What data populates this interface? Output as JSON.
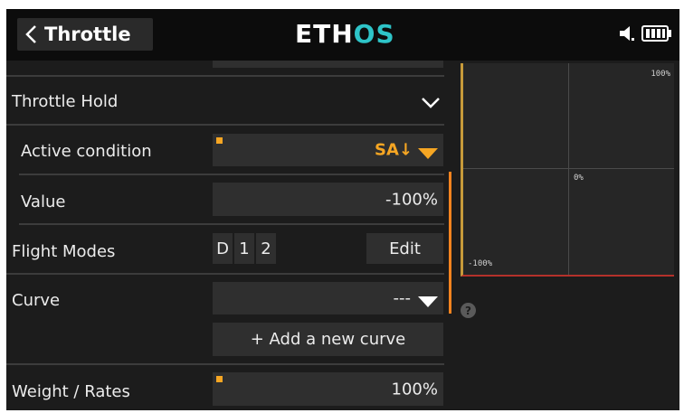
{
  "header": {
    "title": "Throttle",
    "logo_main": "ETH",
    "logo_accent": "OS"
  },
  "rows": {
    "throttle_hold": {
      "label": "Throttle Hold"
    },
    "active_condition": {
      "label": "Active condition",
      "value": "SA↓"
    },
    "value": {
      "label": "Value",
      "value": "-100%"
    },
    "flight_modes": {
      "label": "Flight Modes",
      "modes": [
        "D",
        "1",
        "2"
      ],
      "edit_label": "Edit"
    },
    "curve": {
      "label": "Curve",
      "value": "---",
      "add_label": "+ Add a new curve"
    },
    "weight_rates": {
      "label": "Weight / Rates",
      "value": "100%"
    }
  },
  "graph": {
    "top_right": "100%",
    "center": "0%",
    "bottom_left": "-100%"
  },
  "colors": {
    "accent": "#f6a623",
    "scrollbar": "#f6831f",
    "logo_accent": "#2ec4c8",
    "graph_bottom": "#b5312b"
  },
  "icons": [
    "back-chevron-icon",
    "speaker-icon",
    "battery-icon",
    "dropdown-caret-icon",
    "help-icon"
  ]
}
